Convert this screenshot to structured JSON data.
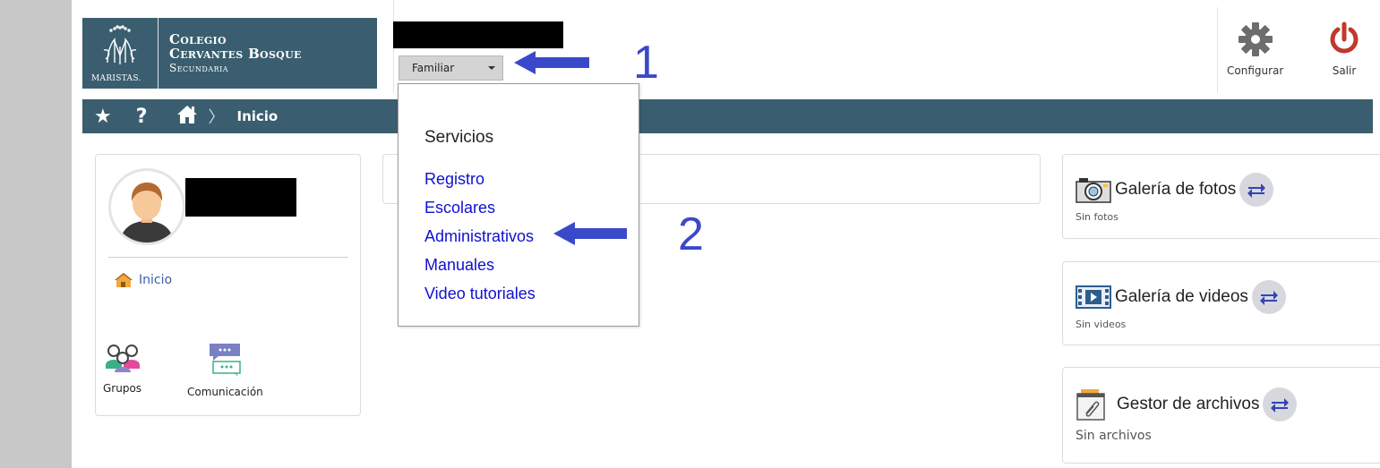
{
  "logo": {
    "emblem_text": "MARISTAS.",
    "line1": "Colegio",
    "line2": "Cervantes Bosque",
    "line3": "Secundaria"
  },
  "header": {
    "profile_select_value": "Familiar",
    "configure_label": "Configurar",
    "exit_label": "Salir"
  },
  "navbar": {
    "star_glyph": "★",
    "help_glyph": "?",
    "separator": "〉",
    "breadcrumb": "Inicio"
  },
  "sidebar": {
    "home_link": "Inicio",
    "tiles": [
      {
        "label": "Grupos"
      },
      {
        "label": "Comunicación"
      }
    ]
  },
  "menu": {
    "heading": "Servicios",
    "items": [
      "Registro",
      "Escolares",
      "Administrativos",
      "Manuales",
      "Video tutoriales"
    ]
  },
  "widgets": [
    {
      "title": "Galería de fotos",
      "subtitle": "Sin fotos",
      "icon": "camera-icon"
    },
    {
      "title": "Galería de videos",
      "subtitle": "Sin videos",
      "icon": "film-icon"
    },
    {
      "title": "Gestor de archivos",
      "subtitle": "Sin archivos",
      "icon": "file-manager-icon"
    }
  ],
  "annotations": {
    "step1": "1",
    "step2": "2"
  },
  "colors": {
    "brand": "#3a5e6f",
    "link": "#1010d0",
    "annotation": "#3a49c9",
    "exit": "#c0392b"
  }
}
